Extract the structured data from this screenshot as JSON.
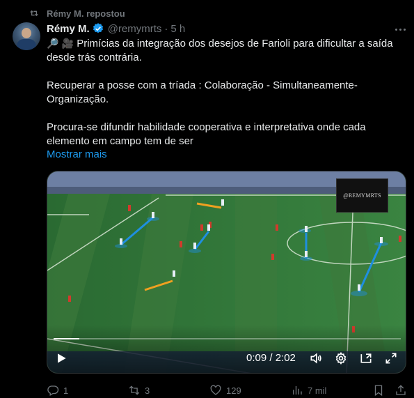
{
  "repost": {
    "label": "Rémy M. repostou"
  },
  "author": {
    "name": "Rémy M.",
    "handle": "@remymrts",
    "separator": "·",
    "time": "5 h"
  },
  "tweet": {
    "line1": "Primícias da integração dos desejos de Farioli para dificultar a saída desde trás contrária.",
    "line2": "Recuperar a posse  com a tríada : Colaboração - Simultaneamente- Organização.",
    "line3": "Procura-se difundir habilidade cooperativa e interpretativa onde cada elemento em campo tem de ser",
    "emoji1": "🔎",
    "emoji2": "🎥",
    "show_more": "Mostrar mais"
  },
  "video": {
    "watermark": "@REMYMRTS",
    "time": "0:09 / 2:02",
    "progress": 0.074
  },
  "actions": {
    "replies": "1",
    "reposts": "3",
    "likes": "129",
    "views": "7 mil"
  },
  "colors": {
    "accent": "#1d9bf0",
    "muted": "#71767b",
    "text": "#e7e9ea",
    "background": "#000000"
  }
}
